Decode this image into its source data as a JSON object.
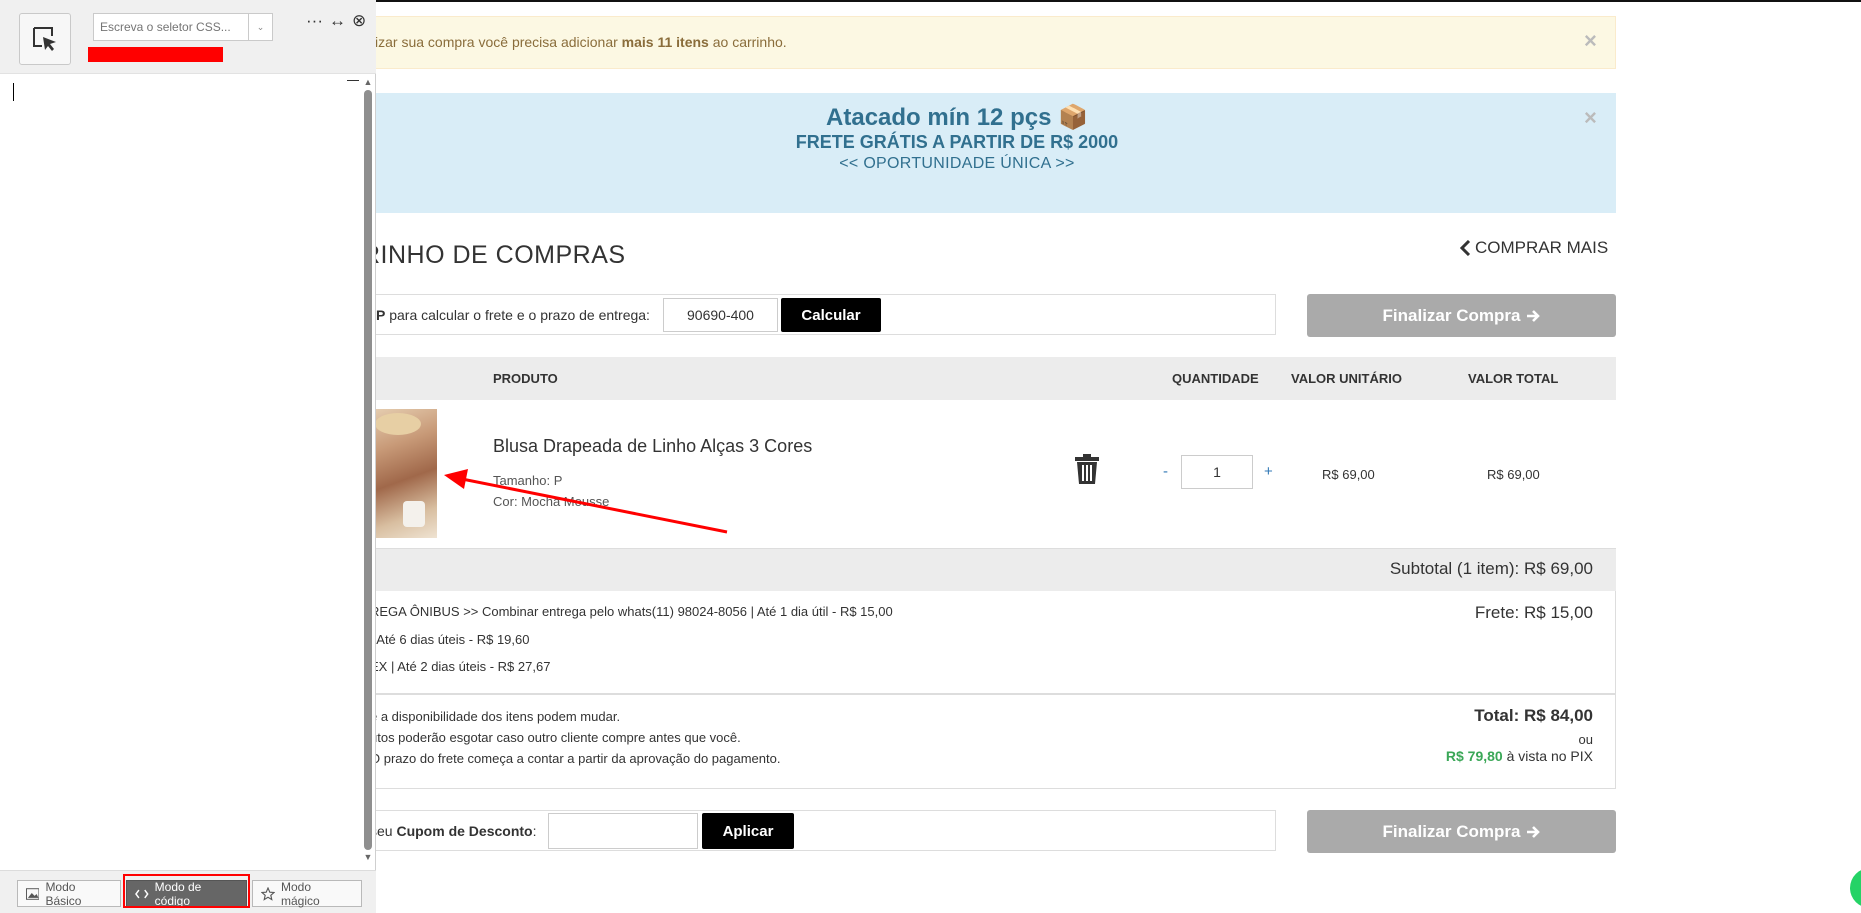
{
  "panel": {
    "selector_placeholder": "Escreva o seletor CSS...",
    "dropdown_glyph": "⌄",
    "tools": {
      "more": "···",
      "resize": "↔",
      "close": "⊗"
    },
    "modes": [
      {
        "label": "Modo Básico",
        "icon": "image-icon"
      },
      {
        "label": "Modo de código",
        "icon": "code-icon"
      },
      {
        "label": "Modo mágico",
        "icon": "star-icon"
      }
    ]
  },
  "banner_warning": {
    "text_before": "izar sua compra você precisa adicionar ",
    "text_bold": "mais 11 itens",
    "text_after": " ao carrinho.",
    "close": "×"
  },
  "banner_promo": {
    "title": "Atacado mín 12 pçs 📦",
    "subtitle": "FRETE GRÁTIS A PARTIR DE R$ 2000",
    "opportunity": "<< OPORTUNIDADE ÚNICA >>",
    "close": "×"
  },
  "cart": {
    "title": "RINHO DE COMPRAS",
    "buy_more": "COMPRAR MAIS",
    "cep": {
      "label_bold": "P",
      "label_text": " para calcular o frete e o prazo de entrega:",
      "value": "90690-400",
      "button": "Calcular"
    },
    "finalize": "Finalizar Compra",
    "headers": {
      "product": "PRODUTO",
      "quantity": "QUANTIDADE",
      "unit_price": "VALOR UNITÁRIO",
      "total_price": "VALOR TOTAL"
    },
    "item": {
      "name": "Blusa Drapeada de Linho Alças 3 Cores",
      "size": "Tamanho: P",
      "color": "Cor: Mocha Mousse",
      "qty_minus": "-",
      "qty": "1",
      "qty_plus": "+",
      "unit_price": "R$ 69,00",
      "total_price": "R$ 69,00"
    },
    "subtotal": "Subtotal (1 item): R$ 69,00",
    "shipping_options": [
      "REGA ÔNIBUS >> Combinar entrega pelo whats(11) 98024-8056 | Até 1 dia útil - R$ 15,00",
      "| Até 6 dias úteis - R$ 19,60",
      "EX | Até 2 dias úteis - R$ 27,67"
    ],
    "frete": "Frete: R$ 15,00",
    "notes": [
      "e a disponibilidade dos itens podem mudar.",
      "utos poderão esgotar caso outro cliente compre antes que você.",
      "O prazo do frete começa a contar a partir da aprovação do pagamento."
    ],
    "total": "Total: R$ 84,00",
    "or": "ou",
    "pix_price": "R$ 79,80",
    "pix_text": " à vista no PIX",
    "coupon": {
      "label_before": "seu ",
      "label_bold": "Cupom de Desconto",
      "label_after": ":",
      "value": "",
      "button": "Aplicar"
    }
  },
  "colors": {
    "annotation_red": "#ff0000",
    "promo_text": "#31708f",
    "pix_green": "#3aa757",
    "finalize_gray": "#aaaaaa"
  }
}
